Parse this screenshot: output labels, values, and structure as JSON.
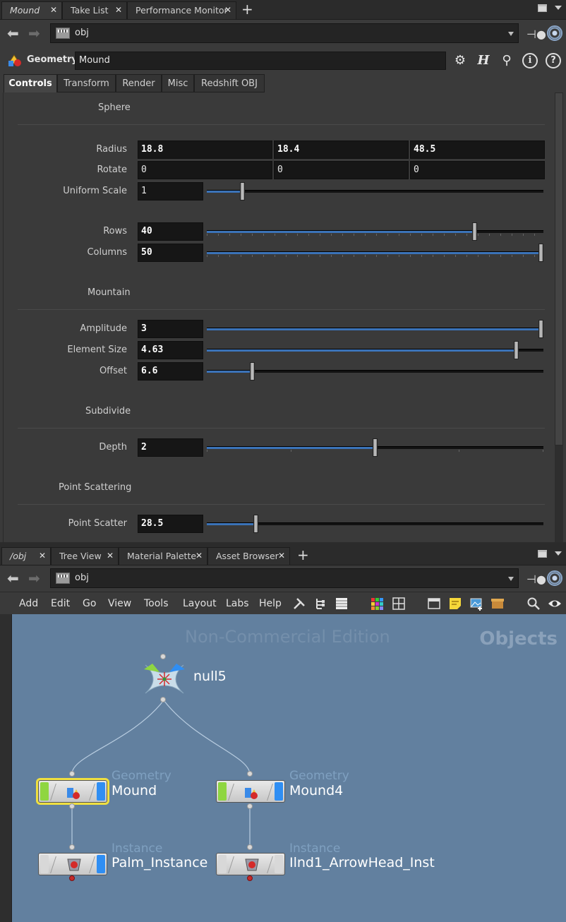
{
  "top_tabs": [
    {
      "label": "Mound",
      "active": true
    },
    {
      "label": "Take List"
    },
    {
      "label": "Performance Monitor"
    }
  ],
  "top_path": "obj",
  "geometry_header": {
    "type_label": "Geometry",
    "name": "Mound"
  },
  "param_tabs": [
    "Controls",
    "Transform",
    "Render",
    "Misc",
    "Redshift OBJ"
  ],
  "sections": {
    "sphere": "Sphere",
    "mountain": "Mountain",
    "subdivide": "Subdivide",
    "point_scattering": "Point Scattering"
  },
  "params": {
    "radius": {
      "label": "Radius",
      "values": [
        "18.8",
        "18.4",
        "48.5"
      ]
    },
    "rotate": {
      "label": "Rotate",
      "values": [
        "0",
        "0",
        "0"
      ]
    },
    "uniform_scale": {
      "label": "Uniform Scale",
      "value": "1",
      "fraction": 0.1
    },
    "rows": {
      "label": "Rows",
      "value": "40",
      "fraction": 0.8
    },
    "columns": {
      "label": "Columns",
      "value": "50",
      "fraction": 1.0
    },
    "amplitude": {
      "label": "Amplitude",
      "value": "3",
      "fraction": 1.0
    },
    "element_size": {
      "label": "Element Size",
      "value": "4.63",
      "fraction": 0.925
    },
    "offset": {
      "label": "Offset",
      "value": "6.6",
      "fraction": 0.13
    },
    "depth": {
      "label": "Depth",
      "value": "2",
      "fraction": 0.5
    },
    "point_scatter": {
      "label": "Point Scatter",
      "value": "28.5",
      "fraction": 0.14
    }
  },
  "bottom_tabs": [
    {
      "label": "/obj",
      "active": true
    },
    {
      "label": "Tree View"
    },
    {
      "label": "Material Palette"
    },
    {
      "label": "Asset Browser"
    }
  ],
  "bottom_path": "obj",
  "menu": [
    "Add",
    "Edit",
    "Go",
    "View",
    "Tools",
    "Layout",
    "Labs",
    "Help"
  ],
  "network": {
    "watermark": "Non-Commercial Edition",
    "context": "Objects",
    "nodes": [
      {
        "name": "null5",
        "type": ""
      },
      {
        "name": "Mound",
        "type": "Geometry"
      },
      {
        "name": "Mound4",
        "type": "Geometry"
      },
      {
        "name": "Palm_Instance",
        "type": "Instance"
      },
      {
        "name": "Ilnd1_ArrowHead_Inst",
        "type": "Instance"
      }
    ]
  },
  "colors": {
    "accent": "#3b73b8",
    "network_bg": "#62809f",
    "selected": "#f0e040",
    "display_flag": "#2f8ef3",
    "bypass_flag": "#8fd641"
  }
}
